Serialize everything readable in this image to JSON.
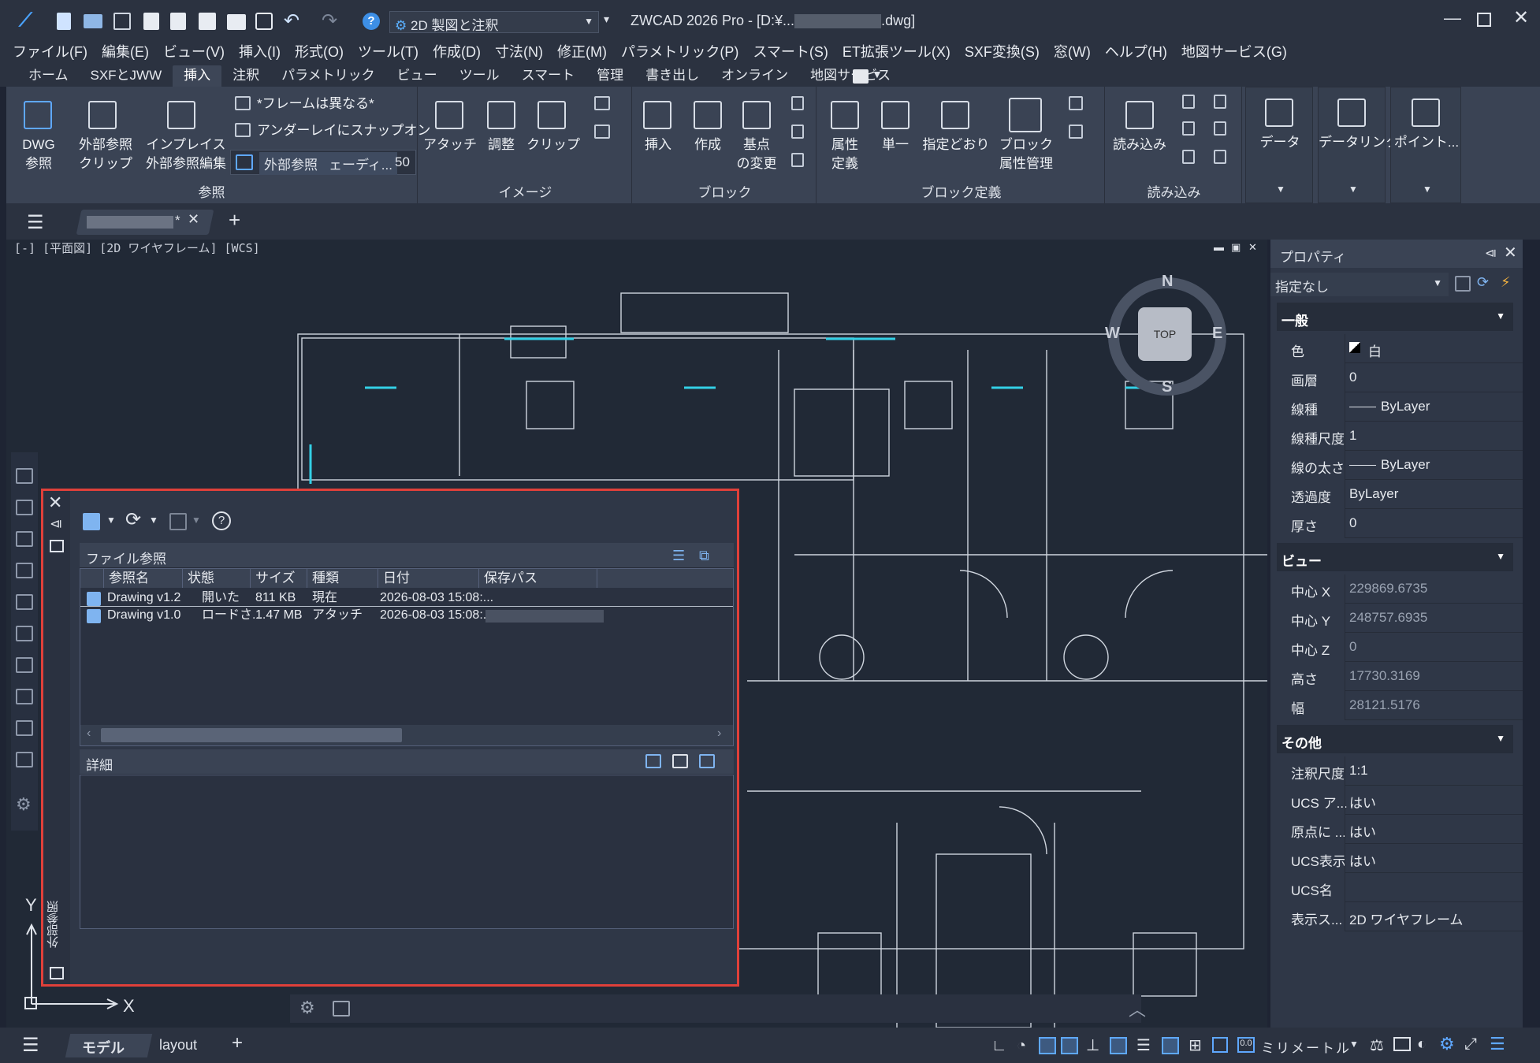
{
  "app": {
    "title": "ZWCAD 2026 Pro - [D:¥...",
    "title_suffix": ".dwg]",
    "workspace": "2D 製図と注釈"
  },
  "menu": [
    "ファイル(F)",
    "編集(E)",
    "ビュー(V)",
    "挿入(I)",
    "形式(O)",
    "ツール(T)",
    "作成(D)",
    "寸法(N)",
    "修正(M)",
    "パラメトリック(P)",
    "スマート(S)",
    "ET拡張ツール(X)",
    "SXF変換(S)",
    "窓(W)",
    "ヘルプ(H)",
    "地図サービス(G)"
  ],
  "ribbon_tabs": [
    "ホーム",
    "SXFとJWW",
    "挿入",
    "注釈",
    "パラメトリック",
    "ビュー",
    "ツール",
    "スマート",
    "管理",
    "書き出し",
    "オンライン",
    "地図サービス"
  ],
  "ribbon_active_tab": "挿入",
  "ribbon": {
    "ref": {
      "label": "参照",
      "dwg": "DWG",
      "dwg2": "参照",
      "xclip": "外部参照",
      "xclip2": "クリップ",
      "inplace": "インプレイス",
      "inplace2": "外部参照編集",
      "frame": "*フレームは異なる*",
      "snap": "アンダーレイにスナップオン",
      "fade_label": "外部参照",
      "fade_label2": "ェーディ...",
      "fade_value": "50"
    },
    "image": {
      "label": "イメージ",
      "attach": "アタッチ",
      "adjust": "調整",
      "clip": "クリップ"
    },
    "block": {
      "label": "ブロック",
      "insert": "挿入",
      "create": "作成",
      "base": "基点",
      "base2": "の変更"
    },
    "blockdef": {
      "label": "ブロック定義",
      "attr": "属性",
      "attr2": "定義",
      "single": "単一",
      "define": "指定どおり",
      "manager": "ブロック",
      "manager2": "属性管理"
    },
    "import": {
      "label": "読み込み",
      "read": "読み込み"
    },
    "data": "データ",
    "datalink": "データリンク",
    "point": "ポイント..."
  },
  "doctab": {
    "name": "*"
  },
  "viewport_label": "[-] [平面図] [2D ワイヤフレーム] [WCS]",
  "compass": {
    "n": "N",
    "s": "S",
    "e": "E",
    "w": "W",
    "top": "TOP"
  },
  "axes": {
    "x": "X",
    "y": "Y"
  },
  "properties": {
    "title": "プロパティ",
    "selection": "指定なし",
    "sections": [
      {
        "name": "一般",
        "rows": [
          [
            "色",
            "白"
          ],
          [
            "画層",
            "0"
          ],
          [
            "線種",
            "ByLayer"
          ],
          [
            "線種尺度",
            "1"
          ],
          [
            "線の太さ",
            "ByLayer"
          ],
          [
            "透過度",
            "ByLayer"
          ],
          [
            "厚さ",
            "0"
          ]
        ]
      },
      {
        "name": "ビュー",
        "rows": [
          [
            "中心 X",
            "229869.6735"
          ],
          [
            "中心 Y",
            "248757.6935"
          ],
          [
            "中心 Z",
            "0"
          ],
          [
            "高さ",
            "17730.3169"
          ],
          [
            "幅",
            "28121.5176"
          ]
        ]
      },
      {
        "name": "その他",
        "rows": [
          [
            "注釈尺度",
            "1:1"
          ],
          [
            "UCS ア...",
            "はい"
          ],
          [
            "原点に ...",
            "はい"
          ],
          [
            "UCS表示",
            "はい"
          ],
          [
            "UCS名",
            ""
          ],
          [
            "表示ス...",
            "2D ワイヤフレーム"
          ]
        ]
      }
    ]
  },
  "xref": {
    "side_label": "外部参照",
    "file_refs_title": "ファイル参照",
    "columns": [
      "参照名",
      "状態",
      "サイズ",
      "種類",
      "日付",
      "保存パス"
    ],
    "rows": [
      {
        "name": "Drawing v1.2",
        "status": "開いた",
        "size": "811 KB",
        "type": "現在",
        "date": "2026-08-03 15:08:...",
        "path": ""
      },
      {
        "name": "Drawing v1.0",
        "status": "ロードさ...",
        "size": "1.47 MB",
        "type": "アタッチ",
        "date": "2026-08-03 15:08:...",
        "path": ""
      }
    ],
    "details_title": "詳細"
  },
  "status": {
    "model": "モデル",
    "layout": "layout",
    "units": "ミリメートル"
  }
}
